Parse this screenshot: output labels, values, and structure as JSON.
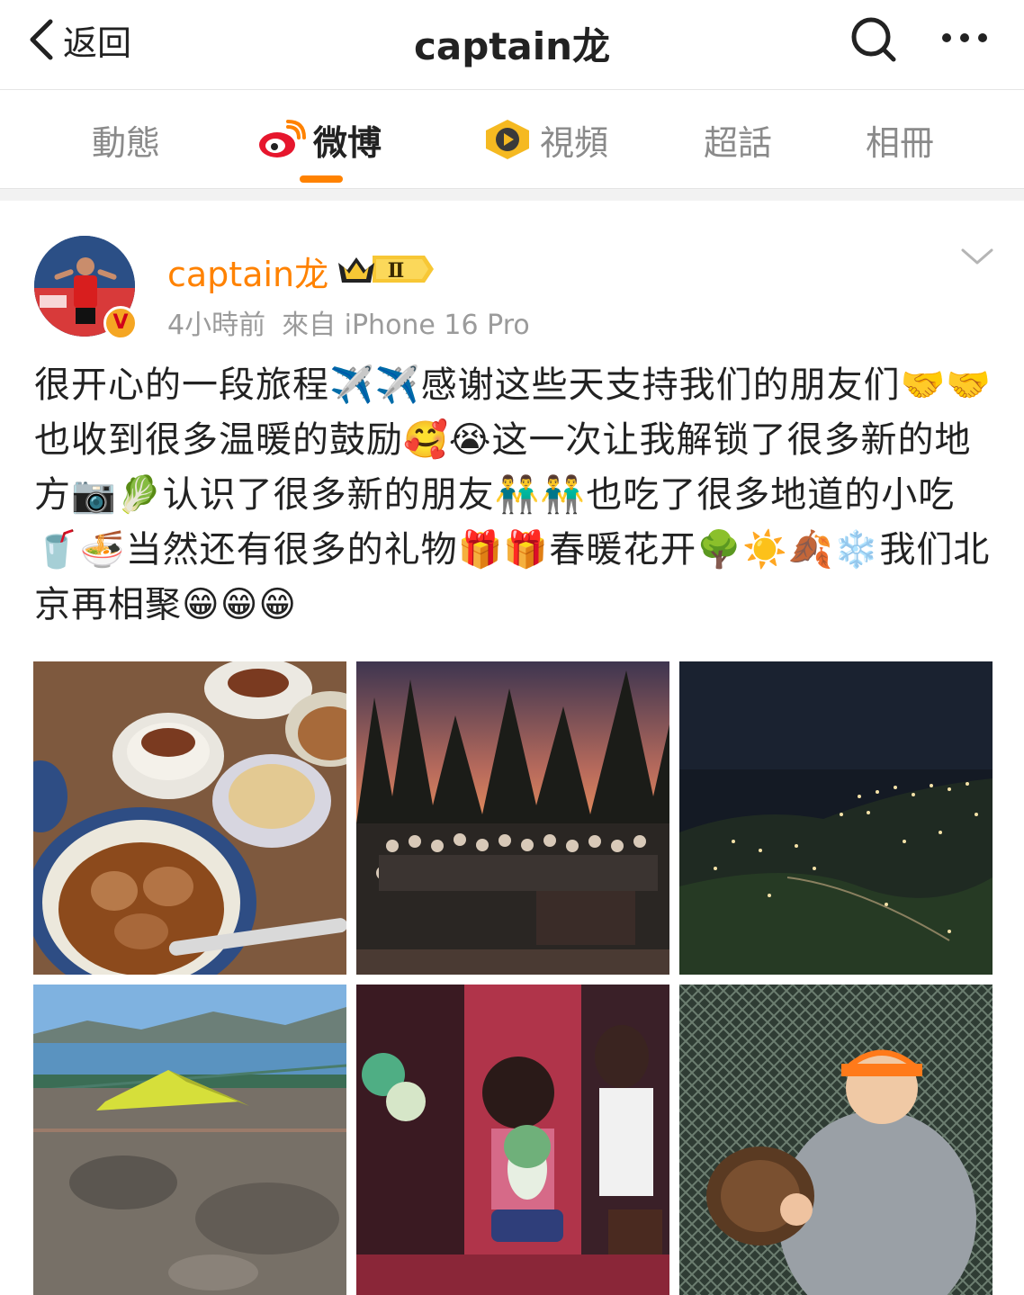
{
  "nav": {
    "back_label": "返回",
    "title": "captain龙"
  },
  "tabs": [
    {
      "label": "動態",
      "active": false
    },
    {
      "label": "微博",
      "active": true,
      "icon": "weibo-logo-icon"
    },
    {
      "label": "視頻",
      "active": false,
      "icon": "video-play-icon"
    },
    {
      "label": "超話",
      "active": false
    },
    {
      "label": "相冊",
      "active": false
    }
  ],
  "post": {
    "author": "captain龙",
    "badge_level": "Ⅱ",
    "verified_mark": "V",
    "time": "4小時前",
    "source": "來自 iPhone 16 Pro",
    "text": "很开心的一段旅程✈️✈️感谢这些天支持我们的朋友们🤝🤝也收到很多温暖的鼓励🥰😭这一次让我解锁了很多新的地方📷🥬认识了很多新的朋友👬👬也吃了很多地道的小吃🥤🍜当然还有很多的礼物🎁🎁春暖花开🌳☀️🍂❄️我们北京再相聚😁😁😁",
    "images": [
      {
        "name": "food-photo"
      },
      {
        "name": "group-night-photo"
      },
      {
        "name": "city-night-photo"
      },
      {
        "name": "lake-view-photo"
      },
      {
        "name": "jade-cabbage-photo"
      },
      {
        "name": "baseball-photo"
      }
    ]
  },
  "colors": {
    "accent": "#ff8200",
    "text": "#222222",
    "muted": "#9b9b9b"
  }
}
